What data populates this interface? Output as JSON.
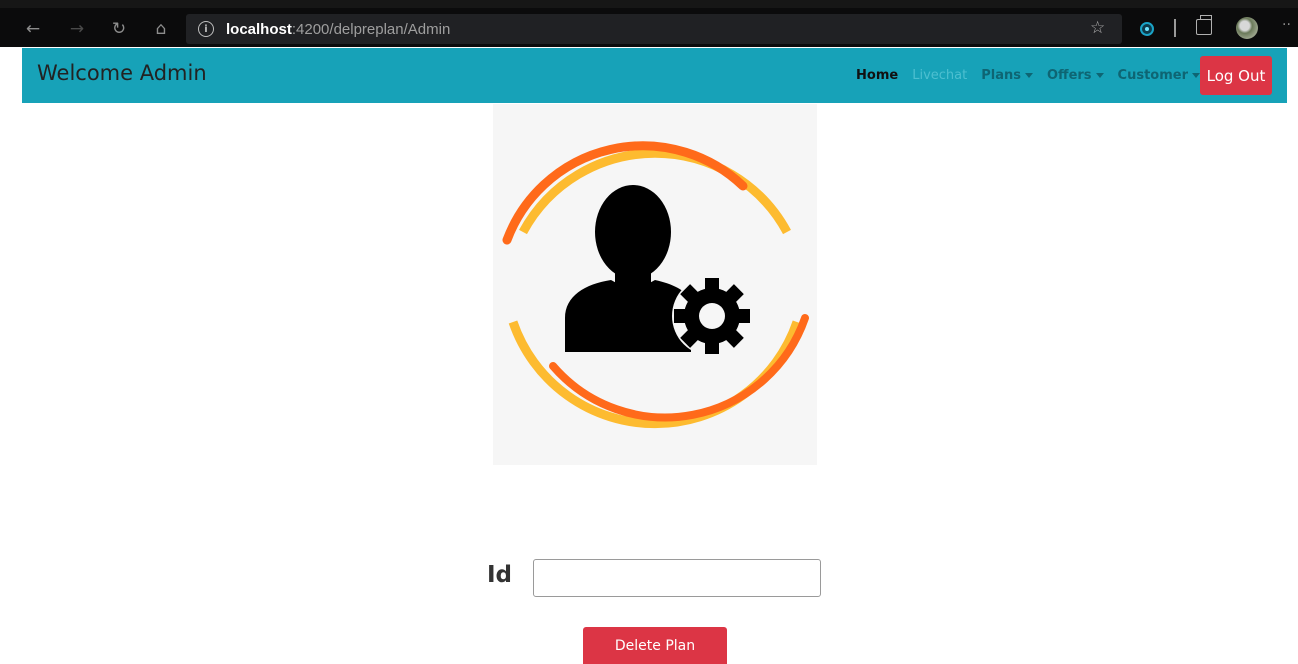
{
  "browser": {
    "url_host": "localhost",
    "url_rest": ":4200/delpreplan/Admin",
    "icons": [
      "back-icon",
      "forward-icon",
      "refresh-icon",
      "home-icon",
      "info-icon",
      "star-icon",
      "extension-icon",
      "collections-icon",
      "profile-avatar",
      "more-icon"
    ]
  },
  "navbar": {
    "brand": "Welcome Admin",
    "links": {
      "home": "Home",
      "livechat": "Livechat",
      "plans": "Plans",
      "offers": "Offers",
      "customer": "Customer"
    },
    "logout_label": "Log Out"
  },
  "form": {
    "id_label": "Id",
    "id_value": "",
    "id_placeholder": "",
    "delete_label": "Delete Plan"
  },
  "colors": {
    "navbar": "#17a2b8",
    "danger": "#dc3545",
    "ring_orange": "#ff6a1a",
    "ring_yellow": "#fdbb30"
  }
}
